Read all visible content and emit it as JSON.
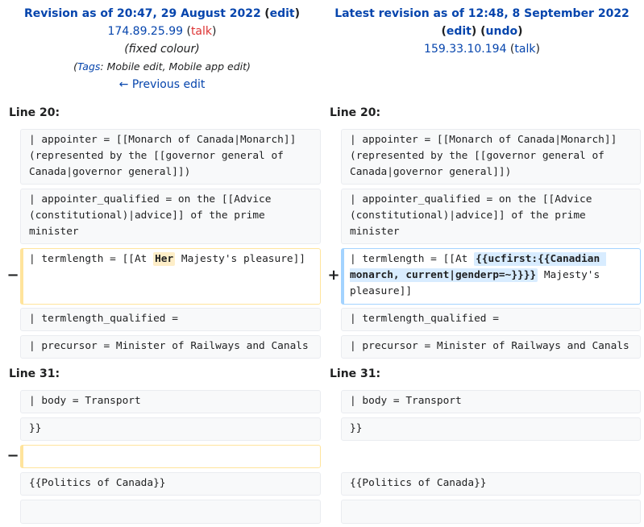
{
  "left_header": {
    "title": "Revision as of 20:47, 29 August 2022",
    "edit_label": "edit",
    "user_ip": "174.89.25.99",
    "talk_label": "talk",
    "summary": "(fixed colour)",
    "tags_label": "Tags",
    "tags_text": ": Mobile edit, Mobile app edit)",
    "prev_edit_label": "← Previous edit"
  },
  "right_header": {
    "title": "Latest revision as of 12:48, 8 September 2022",
    "edit_label": "edit",
    "undo_label": "undo",
    "user_ip": "159.33.10.194",
    "talk_label": "talk"
  },
  "line_labels": {
    "first": "Line 20:",
    "second": "Line 31:"
  },
  "markers": {
    "minus": "−",
    "plus": "+"
  },
  "context": {
    "appointer": "| appointer = [[Monarch of Canada|Monarch]] (represented by the [[governor general of Canada|governor general]])",
    "appointer_qualified": "| appointer_qualified = on the [[Advice (constitutional)|advice]] of the prime minister",
    "termlength_qualified": "| termlength_qualified =",
    "precursor": "| precursor = Minister of Railways and Canals",
    "body": "| body = Transport",
    "close_braces": "}}",
    "politics": "{{Politics of Canada}}"
  },
  "changed": {
    "old_prefix": "| termlength = [[At ",
    "old_highlight": "Her",
    "old_suffix": " Majesty's pleasure]]",
    "new_prefix": "| termlength = [[At ",
    "new_highlight": "{{ucfirst:{{Canadian monarch, current|genderp=~}}}}",
    "new_suffix": " Majesty's pleasure]]"
  }
}
